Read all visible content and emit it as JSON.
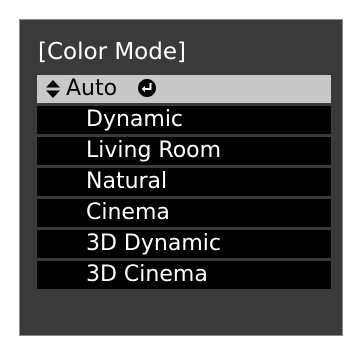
{
  "menu": {
    "title": "[Color Mode]",
    "options": [
      {
        "label": "Auto",
        "selected": true,
        "icons": [
          "up-down-arrows-icon",
          "enter-icon"
        ]
      },
      {
        "label": "Dynamic",
        "selected": false
      },
      {
        "label": "Living Room",
        "selected": false
      },
      {
        "label": "Natural",
        "selected": false
      },
      {
        "label": "Cinema",
        "selected": false
      },
      {
        "label": "3D Dynamic",
        "selected": false
      },
      {
        "label": "3D Cinema",
        "selected": false
      }
    ]
  },
  "colors": {
    "panel_background": "#3a3a3a",
    "item_background": "#000000",
    "selected_background": "#c8c8c8",
    "item_text": "#ffffff",
    "selected_text": "#000000"
  }
}
